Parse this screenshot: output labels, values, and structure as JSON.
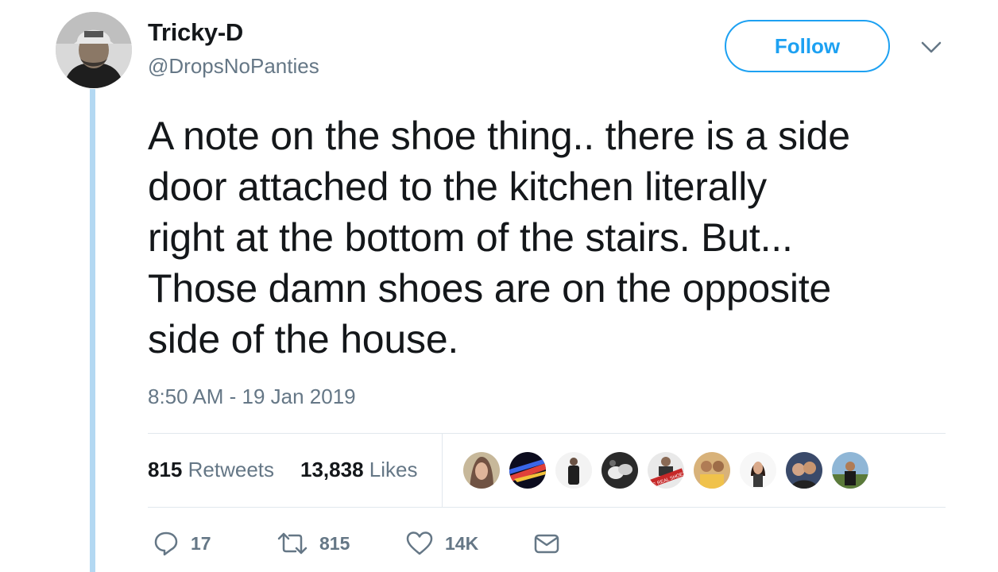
{
  "author": {
    "name": "Tricky-D",
    "handle": "@DropsNoPanties"
  },
  "follow_label": "Follow",
  "tweet": {
    "lines": [
      "A note on the shoe thing.. there is a side",
      "door attached to the kitchen literally",
      "right at the bottom of the stairs.  But...",
      "Those damn shoes are on the opposite",
      "side of the house."
    ],
    "timestamp": "8:50 AM - 19 Jan 2019"
  },
  "stats": {
    "retweets_count": "815",
    "retweets_label": "Retweets",
    "likes_count": "13,838",
    "likes_label": "Likes"
  },
  "liker_avatar_badge": "THE REAL SHOES",
  "actions": {
    "reply_count": "17",
    "retweet_count": "815",
    "like_count": "14K"
  },
  "colors": {
    "accent": "#1da1f2",
    "secondary_text": "#657786",
    "thread_line": "#b3d8f2"
  }
}
